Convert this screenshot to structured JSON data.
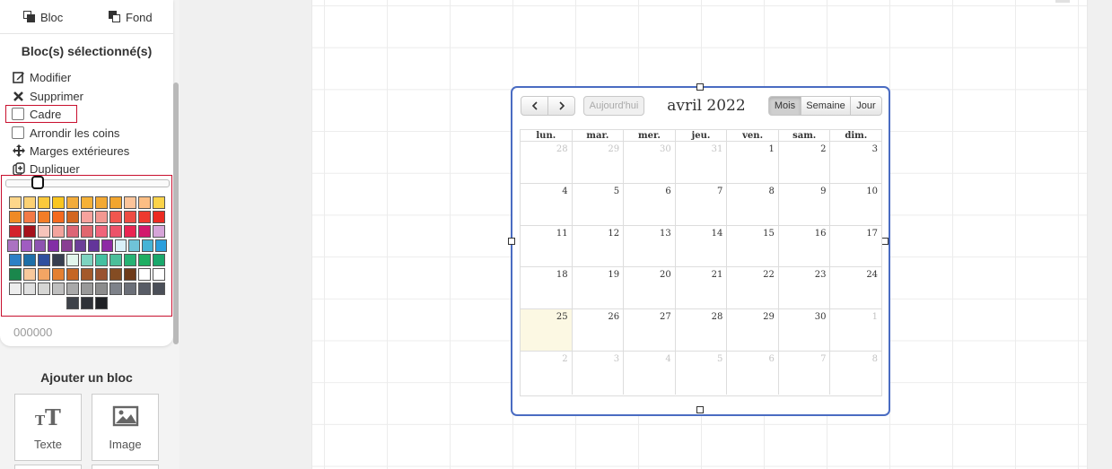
{
  "sidebar": {
    "tabs": {
      "bloc": "Bloc",
      "fond": "Fond"
    },
    "selected_title": "Bloc(s) sélectionné(s)",
    "actions": {
      "modifier": "Modifier",
      "supprimer": "Supprimer",
      "cadre": "Cadre",
      "arrondir": "Arrondir les coins",
      "marges": "Marges extérieures",
      "dupliquer": "Dupliquer"
    },
    "color_picker": {
      "hex_value": "000000",
      "swatches": [
        [
          "#fdd68a",
          "#fcd174",
          "#fbc93c",
          "#f9c51f",
          "#f3ac3b",
          "#f5b138",
          "#f3a934",
          "#f2a52f",
          "#fcc49a",
          "#fcbe84",
          "#fbd34a"
        ],
        [
          "#f08a24",
          "#f37a47",
          "#f37d27",
          "#f46a1e",
          "#d36620",
          "#f7a29d",
          "#f29891",
          "#f1564e",
          "#ed4c43",
          "#ee3a2f",
          "#ec2b22"
        ],
        [
          "#d3222c",
          "#a5121c",
          "#f6c4bb",
          "#f2a49d",
          "#dd6676",
          "#e0676f",
          "#f0647a",
          "#ec5369",
          "#ea2452",
          "#d2196d",
          "#d6a4d8"
        ],
        [
          "#ab72c2",
          "#a05cc1",
          "#8e54b1",
          "#822ea6",
          "#893e93",
          "#6c3f98",
          "#63359a",
          "#8e2ba5",
          "#d9f0f8",
          "#6fc3d8",
          "#46b3d6",
          "#2b9fdd"
        ],
        [
          "#2d80c6",
          "#1e6fa8",
          "#2f4f9e",
          "#373e4f",
          "#e2f6ec",
          "#7dd3c0",
          "#45c0a1",
          "#4bbf9a",
          "#26b274",
          "#1fae62",
          "#1aa86c"
        ],
        [
          "#1a874c",
          "#f8c99c",
          "#f3a564",
          "#e48031",
          "#c56624",
          "#a4592b",
          "#995230",
          "#844c23",
          "#6e3b1a",
          "#ffffff",
          "#ffffff"
        ],
        [
          "#ededed",
          "#e0e0e0",
          "#d6d6d4",
          "#bfbfbf",
          "#a9a9a9",
          "#999999",
          "#8c8c8c",
          "#7e828a",
          "#6b6f78",
          "#585c66",
          "#4b4f58"
        ],
        [
          "#3e4249",
          "#2f3238",
          "#1f2125"
        ]
      ]
    },
    "add_block": {
      "title": "Ajouter un bloc",
      "text_label": "Texte",
      "image_label": "Image"
    }
  },
  "calendar": {
    "title": "avril 2022",
    "prev_label": "<",
    "next_label": ">",
    "today_label": "Aujourd'hui",
    "views": {
      "month": "Mois",
      "week": "Semaine",
      "day": "Jour"
    },
    "active_view": "Mois",
    "weekdays": [
      "lun.",
      "mar.",
      "mer.",
      "jeu.",
      "ven.",
      "sam.",
      "dim."
    ],
    "weeks": [
      [
        {
          "d": "28",
          "o": true
        },
        {
          "d": "29",
          "o": true
        },
        {
          "d": "30",
          "o": true
        },
        {
          "d": "31",
          "o": true
        },
        {
          "d": "1"
        },
        {
          "d": "2"
        },
        {
          "d": "3"
        }
      ],
      [
        {
          "d": "4"
        },
        {
          "d": "5"
        },
        {
          "d": "6"
        },
        {
          "d": "7"
        },
        {
          "d": "8"
        },
        {
          "d": "9"
        },
        {
          "d": "10"
        }
      ],
      [
        {
          "d": "11"
        },
        {
          "d": "12"
        },
        {
          "d": "13"
        },
        {
          "d": "14"
        },
        {
          "d": "15"
        },
        {
          "d": "16"
        },
        {
          "d": "17"
        }
      ],
      [
        {
          "d": "18"
        },
        {
          "d": "19"
        },
        {
          "d": "20"
        },
        {
          "d": "21"
        },
        {
          "d": "22"
        },
        {
          "d": "23"
        },
        {
          "d": "24"
        }
      ],
      [
        {
          "d": "25",
          "t": true
        },
        {
          "d": "26"
        },
        {
          "d": "27"
        },
        {
          "d": "28"
        },
        {
          "d": "29"
        },
        {
          "d": "30"
        },
        {
          "d": "1",
          "o": true
        }
      ],
      [
        {
          "d": "2",
          "o": true
        },
        {
          "d": "3",
          "o": true
        },
        {
          "d": "4",
          "o": true
        },
        {
          "d": "5",
          "o": true
        },
        {
          "d": "6",
          "o": true
        },
        {
          "d": "7",
          "o": true
        },
        {
          "d": "8",
          "o": true
        }
      ]
    ]
  }
}
